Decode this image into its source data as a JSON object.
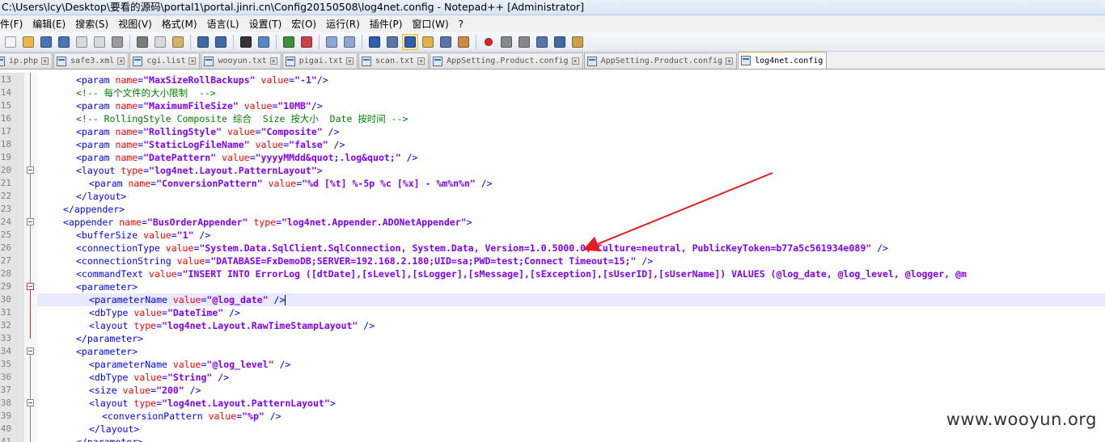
{
  "window": {
    "title": "C:\\Users\\lcy\\Desktop\\要看的源码\\portal1\\portal.jinri.cn\\Config20150508\\log4net.config - Notepad++ [Administrator]"
  },
  "menu": [
    "件(F)",
    "编辑(E)",
    "搜索(S)",
    "视图(V)",
    "格式(M)",
    "语言(L)",
    "设置(T)",
    "宏(O)",
    "运行(R)",
    "插件(P)",
    "窗口(W)",
    "?"
  ],
  "tabs": [
    {
      "label": "ip.php"
    },
    {
      "label": "safe3.xml"
    },
    {
      "label": "cgi.list"
    },
    {
      "label": "wooyun.txt"
    },
    {
      "label": "pigai.txt"
    },
    {
      "label": "scan.txt"
    },
    {
      "label": "AppSetting.Product.config"
    },
    {
      "label": "AppSetting.Product.config"
    },
    {
      "label": "log4net.config"
    }
  ],
  "editor": {
    "lines": [
      {
        "n": "13",
        "i": 3,
        "p": [
          [
            "t",
            "<param "
          ],
          [
            "a",
            "name"
          ],
          [
            "t",
            "="
          ],
          [
            "s",
            "\"MaxSizeRollBackups\""
          ],
          [
            "t",
            " "
          ],
          [
            "a",
            "value"
          ],
          [
            "t",
            "="
          ],
          [
            "s",
            "\"-1\""
          ],
          [
            "t",
            "/>"
          ]
        ]
      },
      {
        "n": "14",
        "i": 3,
        "p": [
          [
            "c",
            "<!-- 每个文件的大小限制  -->"
          ]
        ]
      },
      {
        "n": "15",
        "i": 3,
        "p": [
          [
            "t",
            "<param "
          ],
          [
            "a",
            "name"
          ],
          [
            "t",
            "="
          ],
          [
            "s",
            "\"MaximumFileSize\""
          ],
          [
            "t",
            " "
          ],
          [
            "a",
            "value"
          ],
          [
            "t",
            "="
          ],
          [
            "s",
            "\"10MB\""
          ],
          [
            "t",
            "/>"
          ]
        ]
      },
      {
        "n": "16",
        "i": 3,
        "p": [
          [
            "c",
            "<!-- RollingStyle Composite 综合  Size 按大小  Date 按时间 -->"
          ]
        ]
      },
      {
        "n": "17",
        "i": 3,
        "p": [
          [
            "t",
            "<param "
          ],
          [
            "a",
            "name"
          ],
          [
            "t",
            "="
          ],
          [
            "s",
            "\"RollingStyle\""
          ],
          [
            "t",
            " "
          ],
          [
            "a",
            "value"
          ],
          [
            "t",
            "="
          ],
          [
            "s",
            "\"Composite\""
          ],
          [
            "t",
            " />"
          ]
        ]
      },
      {
        "n": "18",
        "i": 3,
        "p": [
          [
            "t",
            "<param "
          ],
          [
            "a",
            "name"
          ],
          [
            "t",
            "="
          ],
          [
            "s",
            "\"StaticLogFileName\""
          ],
          [
            "t",
            " "
          ],
          [
            "a",
            "value"
          ],
          [
            "t",
            "="
          ],
          [
            "s",
            "\"false\""
          ],
          [
            "t",
            " />"
          ]
        ]
      },
      {
        "n": "19",
        "i": 3,
        "p": [
          [
            "t",
            "<param "
          ],
          [
            "a",
            "name"
          ],
          [
            "t",
            "="
          ],
          [
            "s",
            "\"DatePattern\""
          ],
          [
            "t",
            " "
          ],
          [
            "a",
            "value"
          ],
          [
            "t",
            "="
          ],
          [
            "s",
            "\"yyyyMMdd&quot;.log&quot;\""
          ],
          [
            "t",
            " />"
          ]
        ]
      },
      {
        "n": "20",
        "i": 3,
        "p": [
          [
            "t",
            "<layout "
          ],
          [
            "a",
            "type"
          ],
          [
            "t",
            "="
          ],
          [
            "s",
            "\"log4net.Layout.PatternLayout\""
          ],
          [
            "t",
            ">"
          ]
        ]
      },
      {
        "n": "21",
        "i": 4,
        "p": [
          [
            "t",
            "<param "
          ],
          [
            "a",
            "name"
          ],
          [
            "t",
            "="
          ],
          [
            "s",
            "\"ConversionPattern\""
          ],
          [
            "t",
            " "
          ],
          [
            "a",
            "value"
          ],
          [
            "t",
            "="
          ],
          [
            "s",
            "\"%d [%t] %-5p %c [%x] - %m%n%n\""
          ],
          [
            "t",
            " />"
          ]
        ]
      },
      {
        "n": "22",
        "i": 3,
        "p": [
          [
            "t",
            "</layout>"
          ]
        ]
      },
      {
        "n": "23",
        "i": 2,
        "p": [
          [
            "t",
            "</appender>"
          ]
        ]
      },
      {
        "n": "24",
        "i": 2,
        "p": [
          [
            "t",
            "<appender "
          ],
          [
            "a",
            "name"
          ],
          [
            "t",
            "="
          ],
          [
            "s",
            "\"BusOrderAppender\""
          ],
          [
            "t",
            " "
          ],
          [
            "a",
            "type"
          ],
          [
            "t",
            "="
          ],
          [
            "s",
            "\"log4net.Appender.ADONetAppender\""
          ],
          [
            "t",
            ">"
          ]
        ]
      },
      {
        "n": "25",
        "i": 3,
        "p": [
          [
            "t",
            "<bufferSize "
          ],
          [
            "a",
            "value"
          ],
          [
            "t",
            "="
          ],
          [
            "s",
            "\"1\""
          ],
          [
            "t",
            " />"
          ]
        ]
      },
      {
        "n": "26",
        "i": 3,
        "p": [
          [
            "t",
            "<connectionType "
          ],
          [
            "a",
            "value"
          ],
          [
            "t",
            "="
          ],
          [
            "s",
            "\"System.Data.SqlClient.SqlConnection, System.Data, Version=1.0.5000.0, Culture=neutral, PublicKeyToken=b77a5c561934e089\""
          ],
          [
            "t",
            " />"
          ]
        ]
      },
      {
        "n": "27",
        "i": 3,
        "p": [
          [
            "t",
            "<connectionString "
          ],
          [
            "a",
            "value"
          ],
          [
            "t",
            "="
          ],
          [
            "s",
            "\"DATABASE=FxDemoDB;SERVER=192.168.2.180;UID=sa;PWD=test;Connect Timeout=15;\""
          ],
          [
            "t",
            " />"
          ]
        ]
      },
      {
        "n": "28",
        "i": 3,
        "p": [
          [
            "t",
            "<commandText "
          ],
          [
            "a",
            "value"
          ],
          [
            "t",
            "="
          ],
          [
            "s",
            "\"INSERT INTO ErrorLog ([dtDate],[sLevel],[sLogger],[sMessage],[sException],[sUserID],[sUserName]) VALUES (@log_date, @log_level, @logger, @m"
          ]
        ]
      },
      {
        "n": "29",
        "i": 3,
        "p": [
          [
            "t",
            "<parameter>"
          ]
        ]
      },
      {
        "n": "30",
        "i": 4,
        "current": true,
        "p": [
          [
            "t",
            "<parameterName "
          ],
          [
            "a",
            "value"
          ],
          [
            "t",
            "="
          ],
          [
            "s",
            "\"@log_date\""
          ],
          [
            "t",
            " />"
          ]
        ]
      },
      {
        "n": "31",
        "i": 4,
        "p": [
          [
            "t",
            "<dbType "
          ],
          [
            "a",
            "value"
          ],
          [
            "t",
            "="
          ],
          [
            "s",
            "\"DateTime\""
          ],
          [
            "t",
            " />"
          ]
        ]
      },
      {
        "n": "32",
        "i": 4,
        "p": [
          [
            "t",
            "<layout "
          ],
          [
            "a",
            "type"
          ],
          [
            "t",
            "="
          ],
          [
            "s",
            "\"log4net.Layout.RawTimeStampLayout\""
          ],
          [
            "t",
            " />"
          ]
        ]
      },
      {
        "n": "33",
        "i": 3,
        "p": [
          [
            "t",
            "</parameter>"
          ]
        ]
      },
      {
        "n": "34",
        "i": 3,
        "p": [
          [
            "t",
            "<parameter>"
          ]
        ]
      },
      {
        "n": "35",
        "i": 4,
        "p": [
          [
            "t",
            "<parameterName "
          ],
          [
            "a",
            "value"
          ],
          [
            "t",
            "="
          ],
          [
            "s",
            "\"@log_level\""
          ],
          [
            "t",
            " />"
          ]
        ]
      },
      {
        "n": "36",
        "i": 4,
        "p": [
          [
            "t",
            "<dbType "
          ],
          [
            "a",
            "value"
          ],
          [
            "t",
            "="
          ],
          [
            "s",
            "\"String\""
          ],
          [
            "t",
            " />"
          ]
        ]
      },
      {
        "n": "37",
        "i": 4,
        "p": [
          [
            "t",
            "<size "
          ],
          [
            "a",
            "value"
          ],
          [
            "t",
            "="
          ],
          [
            "s",
            "\"200\""
          ],
          [
            "t",
            " />"
          ]
        ]
      },
      {
        "n": "38",
        "i": 4,
        "p": [
          [
            "t",
            "<layout "
          ],
          [
            "a",
            "type"
          ],
          [
            "t",
            "="
          ],
          [
            "s",
            "\"log4net.Layout.PatternLayout\""
          ],
          [
            "t",
            ">"
          ]
        ]
      },
      {
        "n": "39",
        "i": 5,
        "p": [
          [
            "t",
            "<conversionPattern "
          ],
          [
            "a",
            "value"
          ],
          [
            "t",
            "="
          ],
          [
            "s",
            "\"%p\""
          ],
          [
            "t",
            " />"
          ]
        ]
      },
      {
        "n": "40",
        "i": 4,
        "p": [
          [
            "t",
            "</layout>"
          ]
        ]
      },
      {
        "n": "41",
        "i": 3,
        "p": [
          [
            "t",
            "</parameter>"
          ]
        ]
      }
    ]
  },
  "watermark": "www.wooyun.org",
  "colors": {
    "tag": "#0000ff",
    "attribute": "#ff0000",
    "string": "#8000ff",
    "comment": "#008000",
    "current_line": "#e8e8ff",
    "annotation_arrow": "#e02020"
  },
  "toolbar_icons": [
    "new-file-icon",
    "open-file-icon",
    "save-icon",
    "save-all-icon",
    "close-icon",
    "close-all-icon",
    "print-icon",
    "cut-icon",
    "copy-icon",
    "paste-icon",
    "undo-icon",
    "redo-icon",
    "find-icon",
    "replace-icon",
    "zoom-in-icon",
    "zoom-out-icon",
    "sync-vertical-icon",
    "sync-horizontal-icon",
    "word-wrap-icon",
    "show-all-chars-icon",
    "indent-guide-icon",
    "doc-map-icon",
    "function-list-icon",
    "folder-workspace-icon",
    "record-macro-icon",
    "stop-macro-icon",
    "play-macro-icon",
    "run-macro-multiple-icon",
    "save-macro-icon",
    "spellcheck-icon"
  ]
}
